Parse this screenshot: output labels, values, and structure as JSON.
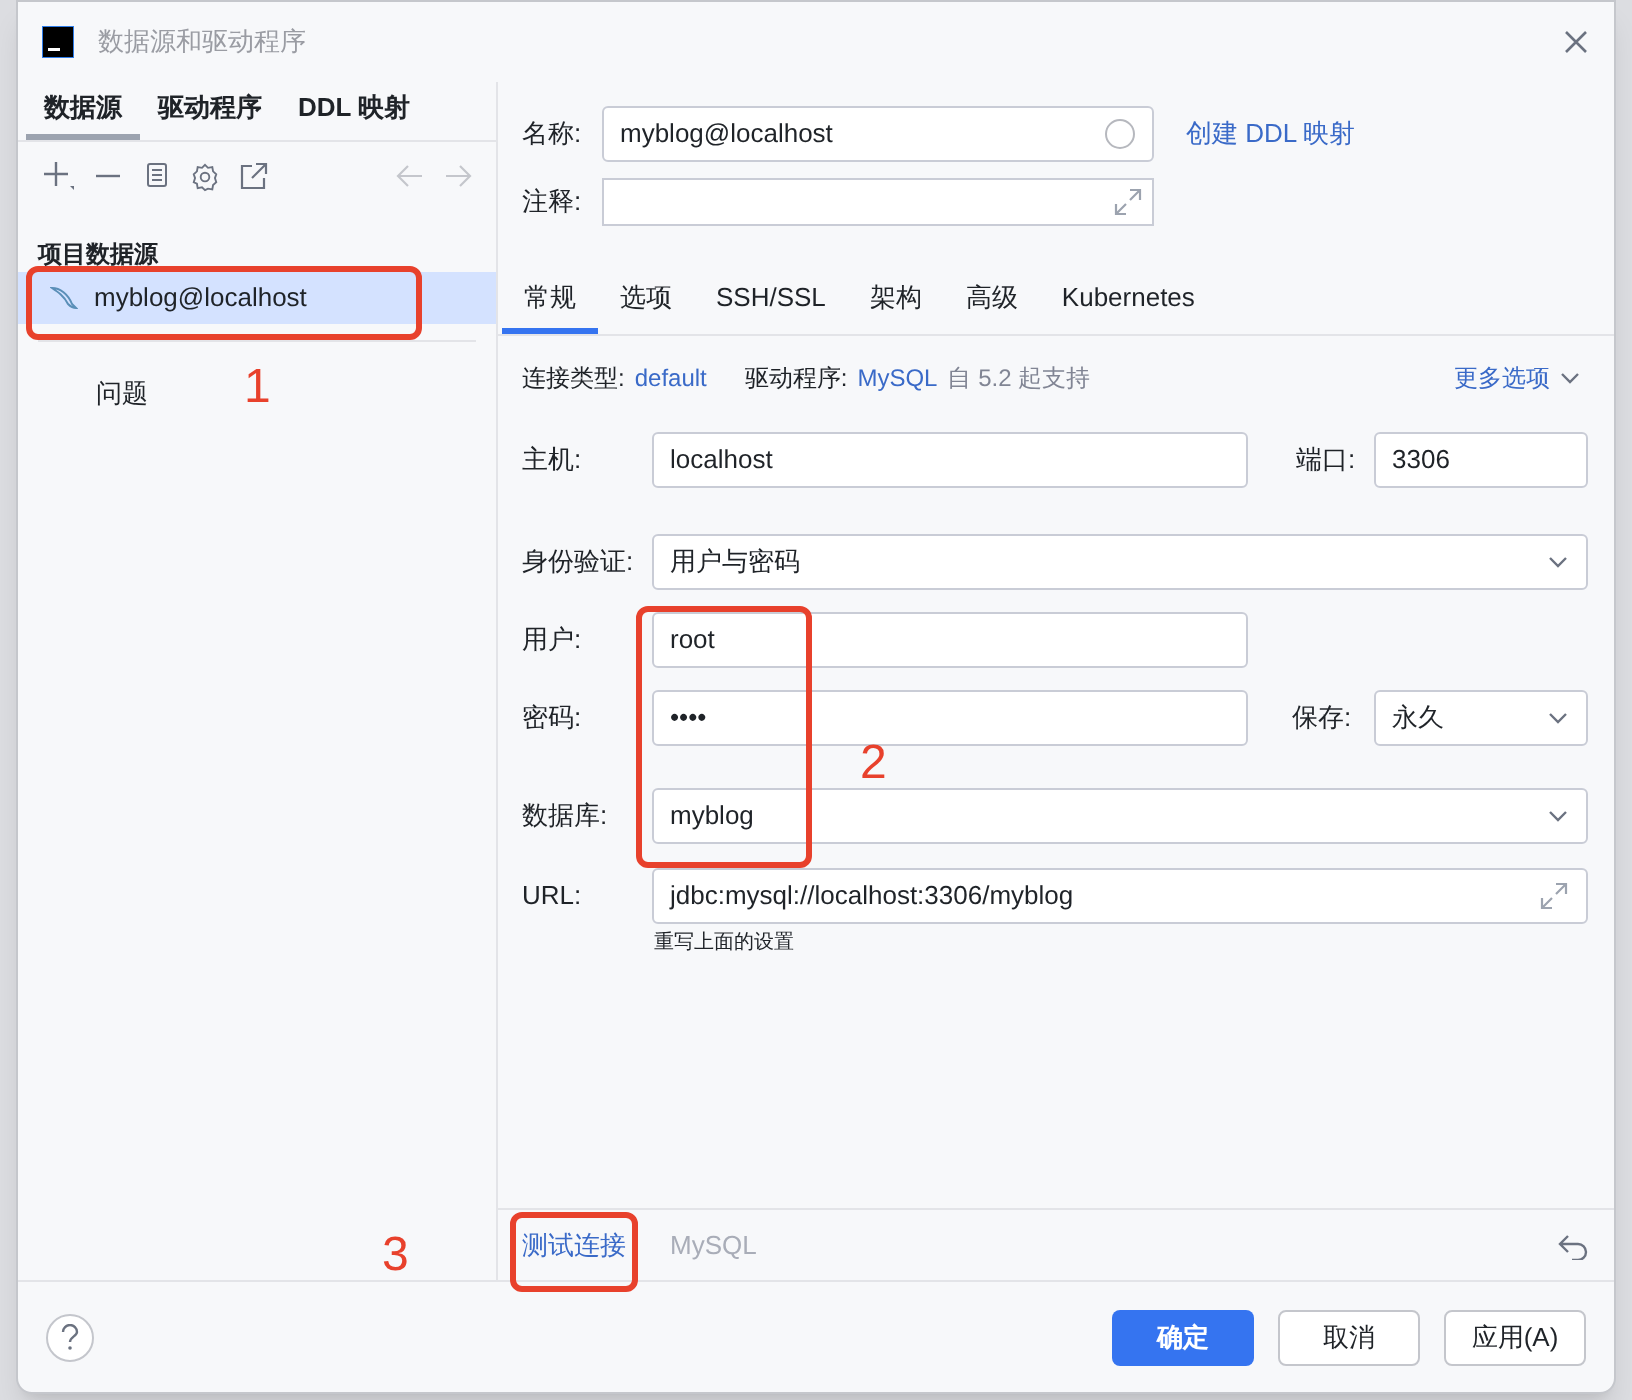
{
  "window": {
    "title": "数据源和驱动程序"
  },
  "left_tabs": [
    {
      "label": "数据源",
      "selected": true
    },
    {
      "label": "驱动程序",
      "selected": false
    },
    {
      "label": "DDL 映射",
      "selected": false
    }
  ],
  "section_title": "项目数据源",
  "data_sources": [
    {
      "label": "myblog@localhost",
      "selected": true
    }
  ],
  "problems": "问题",
  "name_field": {
    "label": "名称:",
    "value": "myblog@localhost"
  },
  "create_ddl_link": "创建 DDL 映射",
  "comment_field": {
    "label": "注释:"
  },
  "tabs": [
    {
      "label": "常规",
      "selected": true
    },
    {
      "label": "选项",
      "selected": false
    },
    {
      "label": "SSH/SSL",
      "selected": false
    },
    {
      "label": "架构",
      "selected": false
    },
    {
      "label": "高级",
      "selected": false
    },
    {
      "label": "Kubernetes",
      "selected": false
    }
  ],
  "connection_info": {
    "type_label": "连接类型:",
    "type_value": "default",
    "driver_label": "驱动程序:",
    "driver_value": "MySQL",
    "driver_note": "自 5.2 起支持",
    "more_options": "更多选项"
  },
  "host": {
    "label": "主机:",
    "value": "localhost"
  },
  "port": {
    "label": "端口:",
    "value": "3306"
  },
  "auth": {
    "label": "身份验证:",
    "value": "用户与密码"
  },
  "user": {
    "label": "用户:",
    "value": "root"
  },
  "password": {
    "label": "密码:",
    "value": "••••"
  },
  "save": {
    "label": "保存:",
    "value": "永久"
  },
  "database": {
    "label": "数据库:",
    "value": "myblog"
  },
  "url": {
    "label": "URL:",
    "value": "jdbc:mysql://localhost:3306/myblog",
    "hint": "重写上面的设置"
  },
  "test_connection": "测试连接",
  "driver_name": "MySQL",
  "buttons": [
    {
      "label": "确定",
      "kind": "primary"
    },
    {
      "label": "取消",
      "kind": "default"
    },
    {
      "label": "应用(A)",
      "kind": "default"
    }
  ],
  "annotations": [
    {
      "label": "1"
    },
    {
      "label": "2"
    },
    {
      "label": "3"
    }
  ]
}
